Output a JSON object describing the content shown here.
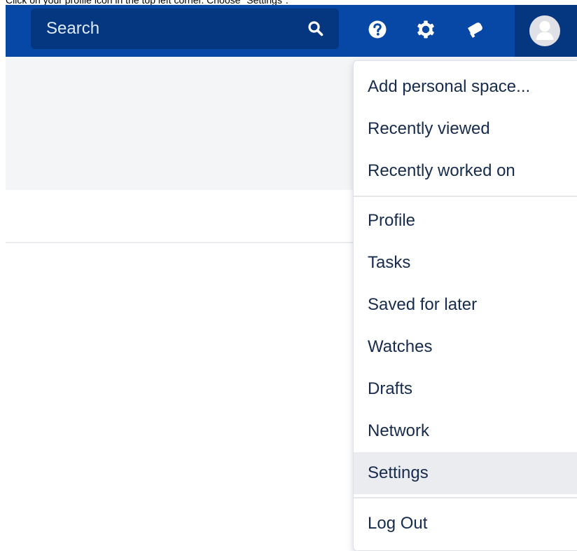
{
  "caption": "Click on your profile icon in the top left corner. Choose \"Settings\".",
  "navbar": {
    "search_placeholder": "Search",
    "icons": {
      "search": "search-icon",
      "help": "help-icon",
      "settings": "gear-icon",
      "notifications": "megaphone-icon",
      "profile": "avatar"
    },
    "colors": {
      "bar": "#0747a6",
      "search_bg": "#053780",
      "icon": "#ffffff"
    }
  },
  "menu": {
    "groups": [
      {
        "items": [
          "Add personal space...",
          "Recently viewed",
          "Recently worked on"
        ]
      },
      {
        "items": [
          "Profile",
          "Tasks",
          "Saved for later",
          "Watches",
          "Drafts",
          "Network",
          "Settings"
        ]
      },
      {
        "items": [
          "Log Out"
        ]
      }
    ],
    "highlighted_item": "Settings"
  }
}
